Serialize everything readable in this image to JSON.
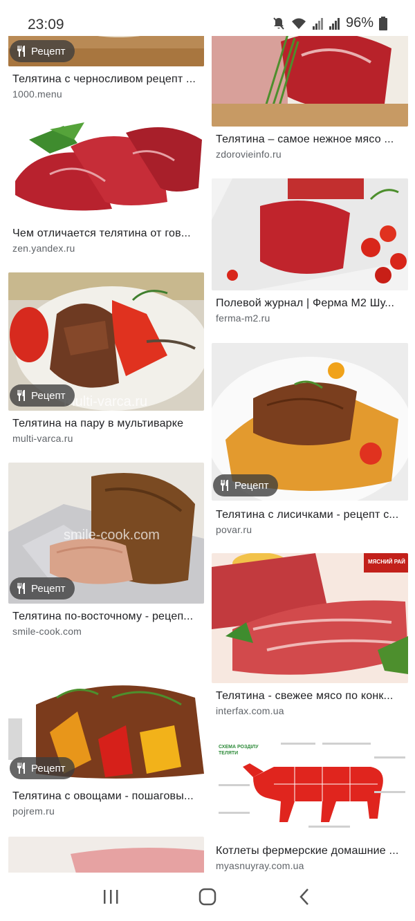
{
  "status": {
    "time": "23:09",
    "battery": "96%"
  },
  "recipe_badge": "Рецепт",
  "results": {
    "left": [
      {
        "title": "Телятина с черносливом рецепт ...",
        "source": "1000.menu"
      },
      {
        "title": "Чем отличается телятина от гов...",
        "source": "zen.yandex.ru"
      },
      {
        "title": "Телятина на пару в мультиварке",
        "source": "multi-varca.ru",
        "watermark": "multi-varca.ru"
      },
      {
        "title": "Телятина по-восточному - рецеп...",
        "source": "smile-cook.com",
        "watermark": "smile-cook.com"
      },
      {
        "title": "Телятина с овощами - пошаговы...",
        "source": "pojrem.ru"
      },
      {
        "title": "",
        "source": ""
      }
    ],
    "right": [
      {
        "title": "Телятина – самое нежное мясо ...",
        "source": "zdorovieinfo.ru"
      },
      {
        "title": "Полевой журнал | Ферма М2 Шу...",
        "source": "ferma-m2.ru"
      },
      {
        "title": "Телятина с лисичками - рецепт с...",
        "source": "povar.ru"
      },
      {
        "title": "Телятина - свежее мясо по конк...",
        "source": "interfax.com.ua",
        "brand": "МЯСНИЙ РАЙ"
      },
      {
        "title": "Котлеты фермерские домашние ...",
        "source": "myasnuyray.com.ua",
        "diagram_title": "СХЕМА РОЗДІЛУ ТЕЛЯТИ"
      }
    ]
  },
  "nav": {
    "recents": "recents-icon",
    "home": "home-icon",
    "back": "back-icon"
  }
}
